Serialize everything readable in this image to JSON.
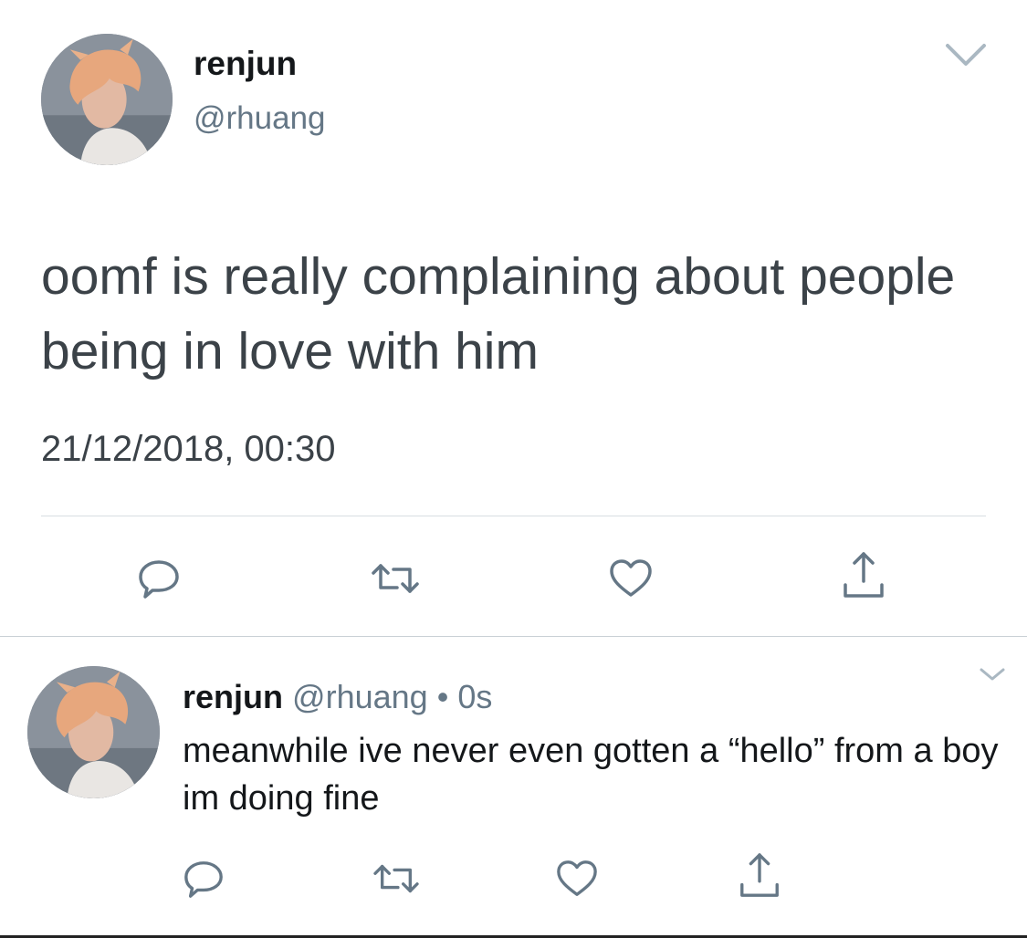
{
  "main_tweet": {
    "display_name": "renjun",
    "handle": "@rhuang",
    "text": "oomf is really complaining about people being in love with him",
    "timestamp": "21/12/2018, 00:30"
  },
  "reply_tweet": {
    "display_name": "renjun",
    "handle": "@rhuang",
    "separator": "•",
    "age": "0s",
    "text": "meanwhile ive never even gotten a “hello” from a boy im doing fine"
  },
  "icons": {
    "reply": "reply-icon",
    "retweet": "retweet-icon",
    "like": "heart-icon",
    "share": "share-icon",
    "menu": "chevron-down-icon"
  },
  "colors": {
    "text_primary": "#14171a",
    "text_secondary": "#657786",
    "icon": "#657786",
    "divider": "#d8dde1"
  }
}
